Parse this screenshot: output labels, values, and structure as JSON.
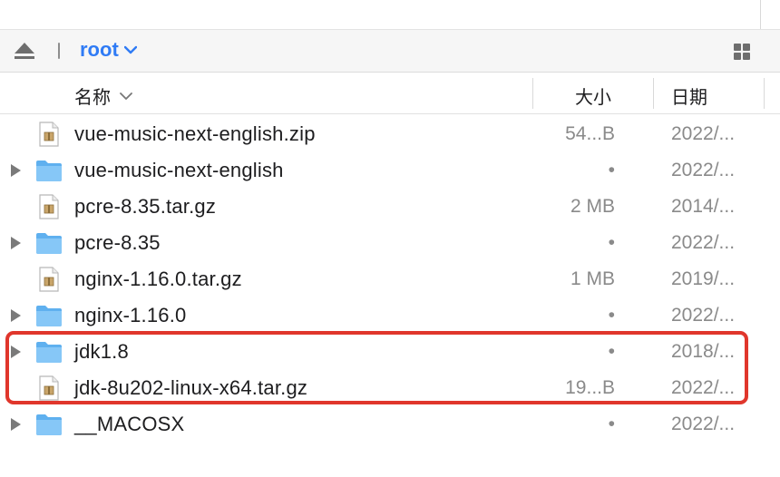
{
  "pathbar": {
    "current_folder": "root",
    "eject_icon": "eject-icon",
    "view_icon": "grid-view-icon"
  },
  "columns": {
    "name": "名称",
    "size": "大小",
    "date": "日期"
  },
  "files": [
    {
      "name": "vue-music-next-english.zip",
      "size": "54...B",
      "date": "2022/...",
      "kind": "archive",
      "expandable": false
    },
    {
      "name": "vue-music-next-english",
      "size": "•",
      "date": "2022/...",
      "kind": "folder",
      "expandable": true
    },
    {
      "name": "pcre-8.35.tar.gz",
      "size": "2 MB",
      "date": "2014/...",
      "kind": "archive",
      "expandable": false
    },
    {
      "name": "pcre-8.35",
      "size": "•",
      "date": "2022/...",
      "kind": "folder",
      "expandable": true
    },
    {
      "name": "nginx-1.16.0.tar.gz",
      "size": "1 MB",
      "date": "2019/...",
      "kind": "archive",
      "expandable": false
    },
    {
      "name": "nginx-1.16.0",
      "size": "•",
      "date": "2022/...",
      "kind": "folder",
      "expandable": true
    },
    {
      "name": "jdk1.8",
      "size": "•",
      "date": "2018/...",
      "kind": "folder",
      "expandable": true
    },
    {
      "name": "jdk-8u202-linux-x64.tar.gz",
      "size": "19...B",
      "date": "2022/...",
      "kind": "archive",
      "expandable": false
    },
    {
      "name": "__MACOSX",
      "size": "•",
      "date": "2022/...",
      "kind": "folder",
      "expandable": true
    }
  ],
  "colors": {
    "accent": "#2f7bf5",
    "highlight": "#e0362c",
    "folder": "#7cc2f5"
  }
}
